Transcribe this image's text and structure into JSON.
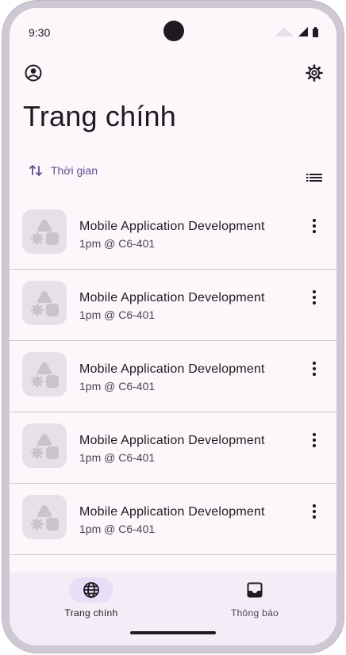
{
  "status_bar": {
    "time": "9:30"
  },
  "app_bar": {
    "title": "Trang chính",
    "account_icon": "account-circle-icon",
    "settings_icon": "settings-icon"
  },
  "sort": {
    "label": "Thời gian",
    "icon": "swap-vert-icon",
    "view_icon": "list-view-icon"
  },
  "list": {
    "items": [
      {
        "title": "Mobile Application Development",
        "subtitle": "1pm @ C6-401"
      },
      {
        "title": "Mobile Application Development",
        "subtitle": "1pm @ C6-401"
      },
      {
        "title": "Mobile Application Development",
        "subtitle": "1pm @ C6-401"
      },
      {
        "title": "Mobile Application Development",
        "subtitle": "1pm @ C6-401"
      },
      {
        "title": "Mobile Application Development",
        "subtitle": "1pm @ C6-401"
      }
    ]
  },
  "bottom_nav": {
    "items": [
      {
        "label": "Trang chính",
        "icon": "globe-icon",
        "active": true
      },
      {
        "label": "Thông báo",
        "icon": "inbox-icon",
        "active": false
      }
    ]
  },
  "colors": {
    "background": "#fdf7fc",
    "accent": "#5d4f8f",
    "nav_indicator": "#e8def8",
    "thumbnail": "#e8e0e9"
  }
}
